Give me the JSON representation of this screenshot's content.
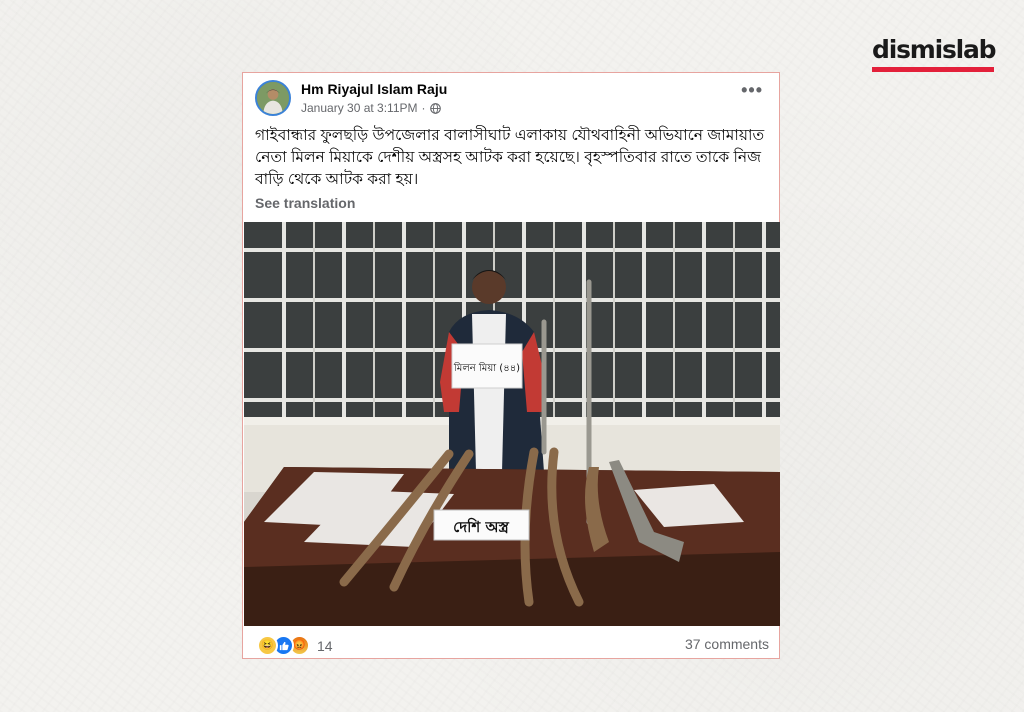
{
  "brand": {
    "logo_text": "dismislab",
    "accent_color": "#e3203a"
  },
  "post": {
    "author": "Hm Riyajul Islam Raju",
    "timestamp": "January 30 at 3:11PM",
    "separator": "·",
    "privacy_icon": "globe-icon",
    "more_icon": "more-options-icon",
    "text": "গাইবান্ধার ফুলছড়ি উপজেলার বালাসীঘাট এলাকায় যৌথবাহিনী অভিযানে জামায়াত নেতা মিলন মিয়াকে দেশীয় অস্ত্রসহ আটক করা হয়েছে। বৃহস্পতিবার রাতে তাকে নিজ বাড়ি থেকে আটক করা হয়।",
    "see_translation": "See translation",
    "photo": {
      "name_placard": "মিলন মিয়া (৪৪)",
      "table_placard": "দেশি অস্ত্র"
    },
    "reactions": {
      "icons": [
        "haha-reaction-icon",
        "like-reaction-icon",
        "angry-reaction-icon"
      ],
      "count": "14"
    },
    "comments": "37 comments"
  }
}
